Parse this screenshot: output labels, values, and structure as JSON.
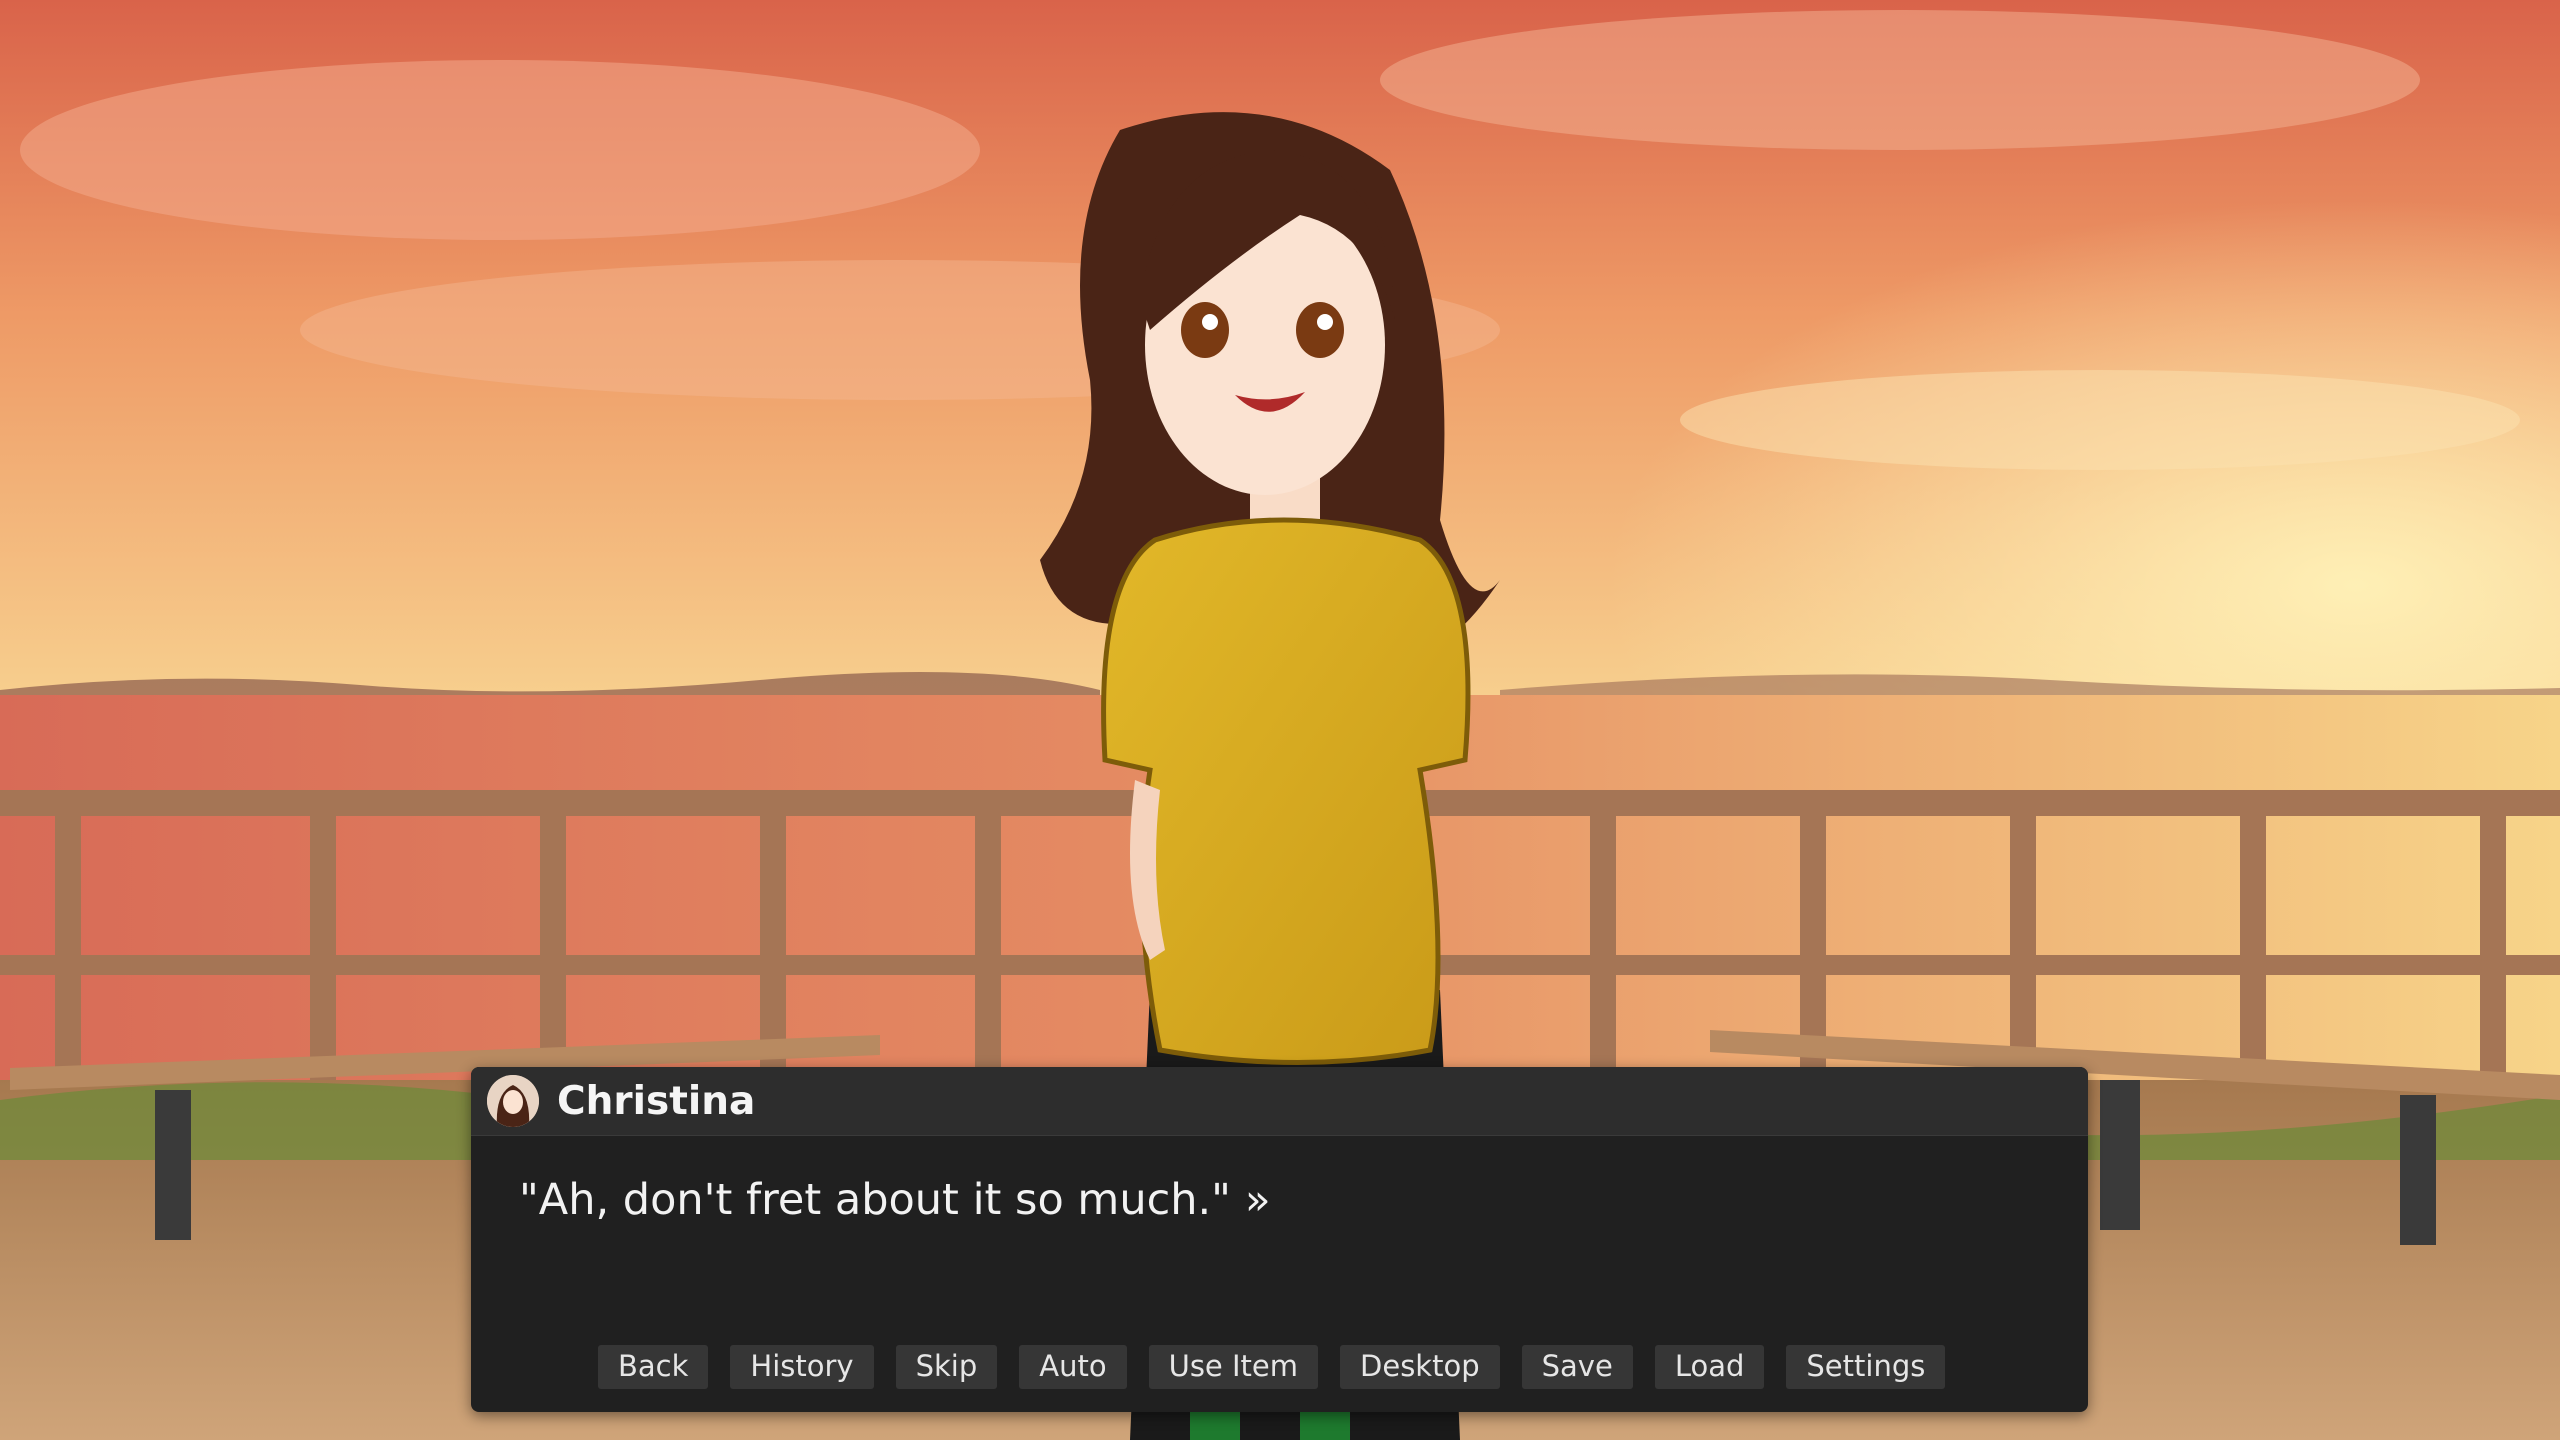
{
  "dialog": {
    "speaker": "Christina",
    "text": "\"Ah, don't fret about it so much.\"",
    "advance_icon": "double-chevron-right-icon"
  },
  "quick_menu": [
    {
      "label": "Back"
    },
    {
      "label": "History"
    },
    {
      "label": "Skip"
    },
    {
      "label": "Auto"
    },
    {
      "label": "Use Item"
    },
    {
      "label": "Desktop"
    },
    {
      "label": "Save"
    },
    {
      "label": "Load"
    },
    {
      "label": "Settings"
    }
  ],
  "colors": {
    "dialog_bg": "#202020",
    "header_bg": "#2d2d2d",
    "button_bg": "#363636",
    "text": "#f2f2f2"
  }
}
